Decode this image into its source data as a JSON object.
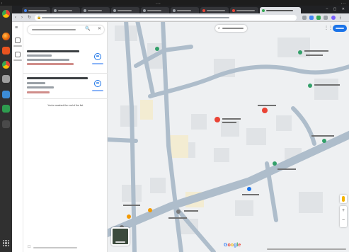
{
  "colors": {
    "road": "#aebdcb",
    "map_bg": "#eef0f2",
    "block": "#e0e3e6",
    "pin_red": "#ea4335",
    "poi_green": "#33a06a",
    "poi_orange": "#f29900",
    "poi_blue": "#1a73e8",
    "brand_blue": "#1a73e8"
  },
  "icons": {
    "menu": "≡",
    "lock": "🔒",
    "magnifier": "🔍",
    "close": "✕",
    "directions": "➦",
    "search_area": "⌕",
    "apps_grid": "⋮⋮",
    "back": "‹",
    "forward": "›",
    "reload": "↻",
    "zoom_in": "+",
    "zoom_out": "−",
    "window_controls": "– ▢ ✕"
  },
  "side_panel": {
    "end_of_list": "You've reached the end of the list."
  },
  "map": {
    "logo": {
      "letters": [
        "G",
        "o",
        "o",
        "g",
        "l",
        "e"
      ],
      "colors": [
        "#4285f4",
        "#ea4335",
        "#fbbc05",
        "#4285f4",
        "#34a853",
        "#ea4335"
      ]
    }
  }
}
